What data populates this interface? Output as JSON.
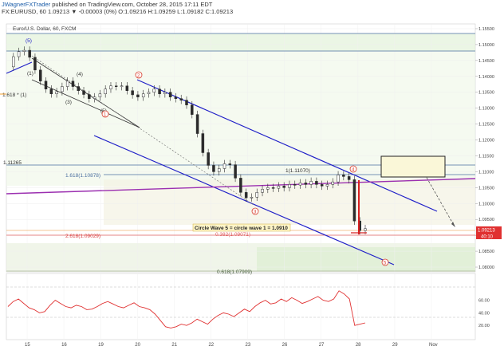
{
  "header": {
    "author": "JWagnerFXTrader",
    "published": "published on TradingView.com, October 28, 2015 17:11 EDT",
    "symbol": "FX:EURUSD, 60",
    "ohlc_text": "1.09213 ▼ -0.00003 (0%) O:1.09216 H:1.09259 L:1.09182 C:1.09213"
  },
  "chart_title": "Euro/U.S. Dollar, 60, FXCM",
  "colors": {
    "candle": "#2b2b2b",
    "channel": "#2020c8",
    "trend": "#9b2fb0",
    "fib": "#4a6ea0",
    "wave": "#d83a2a",
    "rsi": "#e03030",
    "price_tag": "#e03030",
    "green_zone": "#dbeed0",
    "yellow_zone": "#f7f4d8"
  },
  "annotations": {
    "fib_1618_left": "1.618 * (1)",
    "level_1_11265": "1.11265",
    "fib_1618": "1.618(1.10878)",
    "fib_1": "1(1.11070)",
    "circle_wave_note": "Circle Wave 5 = circle wave 1 = 1.0910",
    "fib_2618": "2.618(1.09029)",
    "fib_0382": "0.382(1.09071)",
    "fib_0618": "0.618(1.07909)",
    "last_price_tag": "1.09213",
    "countdown_tag": "40:10"
  },
  "wave_labels": {
    "w5_top": "(5)",
    "w1": "(1)",
    "w3": "(3)",
    "w4": "(4)",
    "w5_small": "(5)",
    "c1": "1",
    "c2": "2",
    "c3": "3",
    "c4": "4",
    "c5": "5"
  },
  "chart_data": {
    "type": "candlestick",
    "title": "Euro/U.S. Dollar, 60, FXCM",
    "x_ticks": [
      "15",
      "16",
      "19",
      "20",
      "21",
      "22",
      "23",
      "26",
      "27",
      "28",
      "29",
      "Nov"
    ],
    "y_ticks": [
      "1.15500",
      "1.15000",
      "1.14500",
      "1.14000",
      "1.13500",
      "1.13000",
      "1.12500",
      "1.12000",
      "1.11500",
      "1.11000",
      "1.10500",
      "1.10000",
      "1.09500",
      "1.09000",
      "1.08500",
      "1.08000"
    ],
    "ylim": [
      1.0785,
      1.1565
    ],
    "close_path": [
      [
        0,
        1.143
      ],
      [
        2,
        1.1462
      ],
      [
        4,
        1.1478
      ],
      [
        6,
        1.1482
      ],
      [
        8,
        1.146
      ],
      [
        10,
        1.142
      ],
      [
        12,
        1.1385
      ],
      [
        14,
        1.136
      ],
      [
        16,
        1.1345
      ],
      [
        18,
        1.1352
      ],
      [
        20,
        1.1368
      ],
      [
        22,
        1.1385
      ],
      [
        24,
        1.1368
      ],
      [
        26,
        1.1355
      ],
      [
        28,
        1.1343
      ],
      [
        30,
        1.133
      ],
      [
        32,
        1.1335
      ],
      [
        34,
        1.1345
      ],
      [
        36,
        1.136
      ],
      [
        38,
        1.137
      ],
      [
        40,
        1.1368
      ],
      [
        42,
        1.137
      ],
      [
        44,
        1.1355
      ],
      [
        46,
        1.1342
      ],
      [
        48,
        1.1335
      ],
      [
        50,
        1.1345
      ],
      [
        52,
        1.135
      ],
      [
        54,
        1.136
      ],
      [
        56,
        1.1345
      ],
      [
        58,
        1.135
      ],
      [
        60,
        1.1335
      ],
      [
        62,
        1.133
      ],
      [
        64,
        1.1325
      ],
      [
        66,
        1.131
      ],
      [
        68,
        1.128
      ],
      [
        70,
        1.122
      ],
      [
        72,
        1.116
      ],
      [
        74,
        1.112
      ],
      [
        76,
        1.11
      ],
      [
        78,
        1.111
      ],
      [
        80,
        1.1125
      ],
      [
        82,
        1.1122
      ],
      [
        84,
        1.108
      ],
      [
        86,
        1.1035
      ],
      [
        88,
        1.1018
      ],
      [
        90,
        1.102
      ],
      [
        92,
        1.1035
      ],
      [
        94,
        1.1045
      ],
      [
        96,
        1.105
      ],
      [
        98,
        1.1048
      ],
      [
        100,
        1.1055
      ],
      [
        102,
        1.105
      ],
      [
        104,
        1.106
      ],
      [
        106,
        1.1058
      ],
      [
        108,
        1.1065
      ],
      [
        110,
        1.106
      ],
      [
        112,
        1.107
      ],
      [
        114,
        1.106
      ],
      [
        116,
        1.1055
      ],
      [
        118,
        1.106
      ],
      [
        120,
        1.1068
      ],
      [
        122,
        1.109
      ],
      [
        124,
        1.1085
      ],
      [
        126,
        1.1075
      ],
      [
        128,
        1.0945
      ],
      [
        130,
        1.0915
      ],
      [
        132,
        1.0921
      ]
    ],
    "rsi": {
      "ylim": [
        0,
        100
      ],
      "ticks": [
        60,
        40,
        20
      ],
      "values": [
        50,
        58,
        62,
        55,
        48,
        45,
        40,
        42,
        52,
        60,
        55,
        50,
        48,
        52,
        50,
        45,
        46,
        50,
        55,
        58,
        54,
        50,
        48,
        52,
        56,
        50,
        48,
        45,
        38,
        28,
        18,
        16,
        18,
        22,
        20,
        24,
        30,
        26,
        22,
        30,
        36,
        40,
        38,
        34,
        40,
        46,
        42,
        50,
        56,
        60,
        54,
        56,
        62,
        58,
        64,
        60,
        55,
        58,
        62,
        66,
        60,
        58,
        62,
        75,
        70,
        62,
        20,
        22,
        24
      ]
    }
  }
}
